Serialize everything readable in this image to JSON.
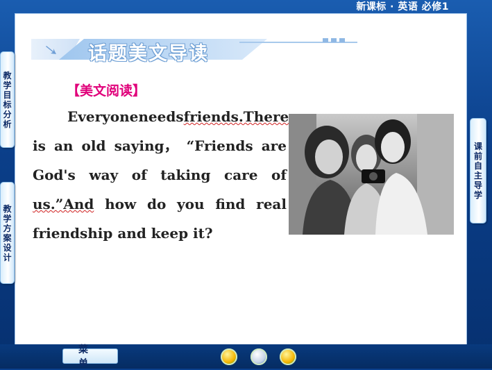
{
  "header": {
    "course_title": "新课标 · 英语  必修1"
  },
  "sidebar_left": [
    {
      "label": "教学目标分析"
    },
    {
      "label": "教学方案设计"
    }
  ],
  "sidebar_right": [
    {
      "label": "课前自主导学"
    }
  ],
  "section": {
    "title": "话题美文导读",
    "label": "【美文阅读】"
  },
  "passage": {
    "lines": [
      [
        "Everyone",
        "needs",
        "friends.There"
      ],
      [
        "is",
        "an",
        "old",
        "saying，",
        "“Friends",
        "are"
      ],
      [
        "God's",
        "way",
        "of",
        "taking",
        "care",
        "of"
      ],
      [
        "us.”And",
        "how",
        "do",
        "you",
        "find",
        "real"
      ],
      [
        "friendship and keep it?"
      ]
    ]
  },
  "image": {
    "icon": "photo-three-girls"
  },
  "footer": {
    "menu_label": "菜单",
    "prev_icon": "prev-arrow-icon",
    "home_icon": "home-icon",
    "next_icon": "next-arrow-icon"
  },
  "colors": {
    "frame": "#0a3f8c",
    "accent": "#e0007a",
    "tab_text": "#0c2a66"
  }
}
